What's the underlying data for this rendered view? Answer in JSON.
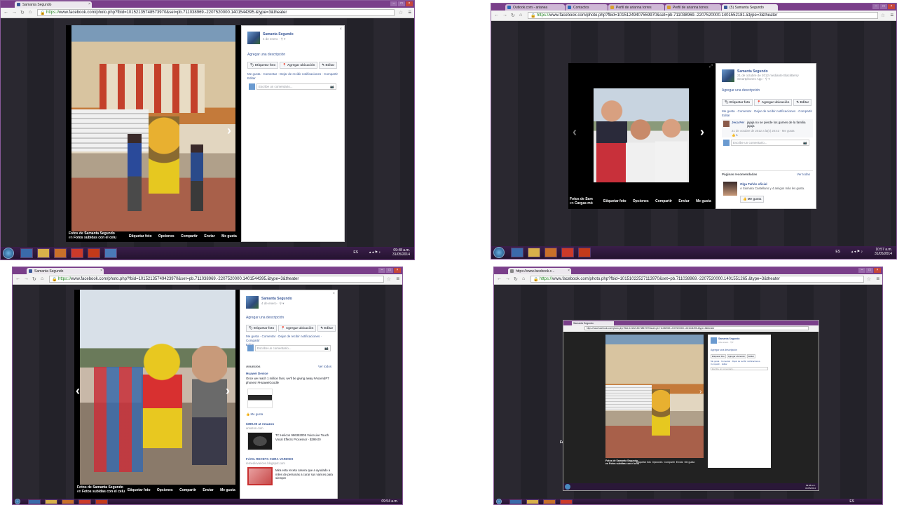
{
  "q1": {
    "tab_title": "Samanta Segundo",
    "url_scheme": "https://",
    "url_rest": "www.facebook.com/photo.php?fbid=10152135748573970&set=pb.711038969.-2207520000.1401544395.&type=3&theater",
    "poster_name": "Samanta Segundo",
    "post_date": "4 de enero · ⚲ ▾",
    "add_description": "Agregar una descripción",
    "btn_tag": "Etiquetar foto",
    "btn_location": "Agregar ubicación",
    "btn_edit": "Editar",
    "actions_line1": "Me gusta · Comentar · Dejar de recibir notificaciones · Compartir",
    "actions_line2": "Editar",
    "comment_placeholder": "Escribe un comentario...",
    "caption_line1": "Fotos de Samanta Segundo",
    "caption_line2_prefix": "en",
    "caption_line2_album": "Fotos subidas con el celu",
    "cap_tag": "Etiquetar foto",
    "cap_options": "Opciones",
    "cap_share": "Compartir",
    "cap_send": "Enviar",
    "cap_like": "Me gusta",
    "tray_lang": "ES",
    "clock_time": "09:48 a.m.",
    "clock_date": "31/05/2014"
  },
  "q2": {
    "tabs": [
      "Outlook.com - arianea",
      "Contactos",
      "Perfil de arianna torres",
      "Perfil de arianna torres",
      "(5) Samanta Segundo"
    ],
    "url_scheme": "https://",
    "url_rest": "www.facebook.com/photo.php?fbid=10151249407559970&set=pb.711038969.-2207520000.1401552181.&type=3&theater",
    "poster_name": "Samanta Segundo",
    "post_date": "21 de octubre de 2012 mediante BlackBerry Smartphones App · ⚲ ▾",
    "add_description": "Agregar una descripción",
    "btn_tag": "Etiquetar foto",
    "btn_location": "Agregar ubicación",
    "btn_edit": "Editar",
    "actions_line1": "Me gusta · Comentar · Dejar de recibir notificaciones · Compartir",
    "actions_line2": "Editar",
    "comment_author": "Jeca Fer",
    "comment_text": "jajaja no se pierde los games de la familia jajaja",
    "comment_meta": "21 de octubre de 2012 a la(s) 20:43 · Me gusta",
    "comment_likes": "👍 1",
    "comment_placeholder": "Escribe un comentario...",
    "recommended_title": "Páginas recomendadas",
    "see_all": "Ver todas",
    "rec_name": "Olga Tañón oficial",
    "rec_text": "A Siomara Castellano y 4 amigos más les gusta.",
    "rec_btn": "👍 Me gusta",
    "caption_line1": "Fotos de Sam",
    "caption_line2_prefix": "en",
    "caption_line2_album": "Cargas mó",
    "cap_tag": "Etiquetar foto",
    "cap_options": "Opciones",
    "cap_share": "Compartir",
    "cap_send": "Enviar",
    "cap_like": "Me gusta",
    "tray_lang": "ES",
    "clock_time": "10:57 a.m.",
    "clock_date": "31/05/2014"
  },
  "q3": {
    "tab_title": "Samanta Segundo",
    "url_scheme": "https://",
    "url_rest": "www.facebook.com/photo.php?fbid=10152135749423970&set=pb.711038969.-2207520000.1401544395.&type=3&theater",
    "poster_name": "Samanta Segundo",
    "post_date": "4 de enero · ⚲ ▾",
    "add_description": "Agregar una descripción",
    "btn_tag": "Etiquetar foto",
    "btn_location": "Agregar ubicación",
    "btn_edit": "Editar",
    "actions_line1": "Me gusta · Comentar · Dejar de recibir notificaciones · Compartir",
    "actions_line2": "Editar",
    "comment_placeholder": "Escribe un comentario...",
    "ads_title": "Anuncios",
    "ads_see_all": "Ver todos",
    "ad1_title": "Huawei Device",
    "ad1_text": "Once we reach 1 million fans, we'll be giving away #AscendP7 phones! #HuaweiGoodle",
    "ad1_like": "👍 Me gusta",
    "ad2_title": "$399.00 at Amazon",
    "ad2_url": "amazon.com",
    "ad2_text": "TC Helicon 996353005 VoiceLive Touch Vocal Effects Processor - $399.00",
    "ad3_title": "FÁCIL RECETA CURA VARICES",
    "ad3_url": "remediovarices.blogspot.com",
    "ad3_text": "Mira esta receta casera que a ayudado a miles de personas a curar sus varices para siempre",
    "caption_line1": "Fotos de Samanta Segundo",
    "caption_line2_prefix": "en",
    "caption_line2_album": "Fotos subidas con el celu",
    "cap_tag": "Etiquetar foto",
    "cap_options": "Opciones",
    "cap_share": "Compartir",
    "cap_send": "Enviar",
    "cap_like": "Me gusta",
    "clock_time": "09:54 a.m."
  },
  "q4": {
    "tab_title": "https://www.facebook.c...",
    "url_scheme": "https://",
    "url_rest": "www.facebook.com/photo.php?fbid=10151022527113970&set=pb.711038969.-2207520000.1401551265.&type=3&theater",
    "nested_tab": "Samanta Segundo",
    "nested_url": "https://www.facebook.com/photo.php?fbid=10152135748573970&set=pb.711038969.-2207520000.1401544395.&type=3&theater",
    "nested_poster": "Samanta Segundo",
    "nested_date": "4 de enero · ⚲ ▾",
    "nested_add_desc": "Agregar una descripción",
    "nested_btn_tag": "Etiquetar foto",
    "nested_btn_location": "Agregar ubicación",
    "nested_btn_edit": "Editar",
    "nested_actions": "Me gusta · Comentar · Dejar de recibir notificaciones · Compartir · Editar",
    "nested_comment": "Escribe un comentario...",
    "nested_caption1": "Fotos de Samanta Segundo",
    "nested_caption2": "en Fotos subidas con el celu",
    "nested_cap_actions": "Etiquetar foto  Opciones  Compartir  Enviar  Me gusta",
    "nested_clock_time": "09:48 a.m.",
    "nested_clock_date": "31/05/2014",
    "tray_lang": "ES",
    "side_letter": "Fo"
  }
}
